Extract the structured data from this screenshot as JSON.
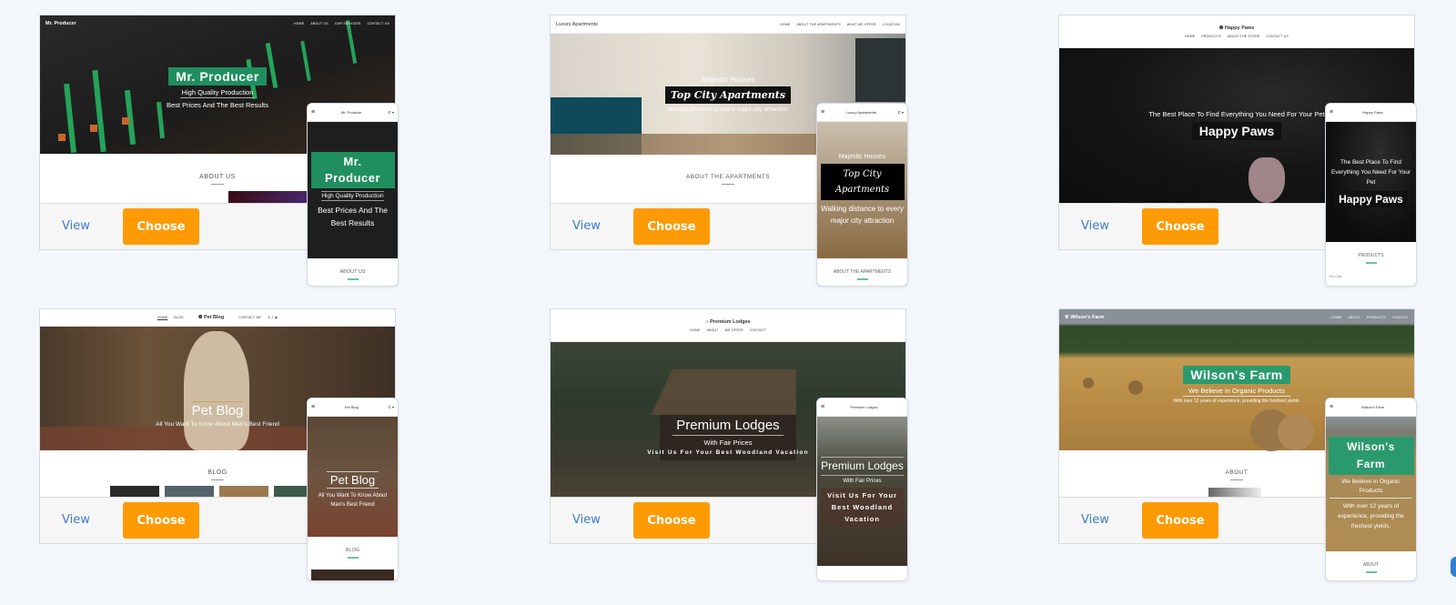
{
  "templates": [
    {
      "name": "Mr. Producer",
      "desktop": {
        "brand": "Mr. Producer",
        "nav_links": [
          "HOME",
          "ABOUT US",
          "OUR SERVICES",
          "CONTACT US"
        ],
        "hero_title": "Mr. Producer",
        "hero_subtitle": "High Quality Production",
        "hero_tagline": "Best Prices And The Best Results",
        "section_label": "ABOUT US"
      },
      "mobile": {
        "brand": "Mr. Producer",
        "hero_title": "Mr. Producer",
        "hero_subtitle": "High Quality Production",
        "hero_tagline": "Best Prices And The Best Results",
        "section_label": "ABOUT US"
      },
      "view_label": "View",
      "choose_label": "Choose"
    },
    {
      "name": "Luxury Apartments",
      "desktop": {
        "brand": "Luxury Apartments",
        "nav_links": [
          "HOME",
          "ABOUT THE APARTMENTS",
          "WHAT WE OFFER",
          "LOCATION"
        ],
        "hero_pretitle": "Majestic Houses",
        "hero_title": "Top City Apartments",
        "hero_subtitle": "Walking distance to every major city attraction",
        "section_label": "ABOUT THE APARTMENTS"
      },
      "mobile": {
        "brand": "Luxury Apartments",
        "hero_pretitle": "Majestic Houses",
        "hero_title": "Top City Apartments",
        "hero_subtitle": "Walking distance to every major city attraction",
        "section_label": "ABOUT THE APARTMENTS"
      },
      "view_label": "View",
      "choose_label": "Choose"
    },
    {
      "name": "Happy Paws",
      "desktop": {
        "brand": "Happy Paws",
        "nav_links": [
          "HOME",
          "PRODUCTS",
          "ABOUT THE STORE",
          "CONTACT US"
        ],
        "hero_pretitle": "The Best Place To Find Everything You Need For Your Pet",
        "hero_title": "Happy Paws"
      },
      "mobile": {
        "brand": "Happy Paws",
        "hero_pretitle": "The Best Place To Find Everything You Need For Your Pet",
        "hero_title": "Happy Paws",
        "section_label": "PRODUCTS",
        "extra_text": "For Cats"
      },
      "view_label": "View",
      "choose_label": "Choose"
    },
    {
      "name": "Pet Blog",
      "desktop": {
        "brand": "Pet Blog",
        "nav_links_left": [
          "HOME",
          "BLOG"
        ],
        "nav_links_right": [
          "CONTACT ME"
        ],
        "hero_title": "Pet Blog",
        "hero_subtitle": "All You Want To Know About Man's Best Friend",
        "section_label": "BLOG"
      },
      "mobile": {
        "brand": "Pet Blog",
        "hero_title": "Pet Blog",
        "hero_subtitle": "All You Want To Know About Man's Best Friend",
        "section_label": "BLOG"
      },
      "view_label": "View",
      "choose_label": "Choose"
    },
    {
      "name": "Premium Lodges",
      "desktop": {
        "brand": "Premium Lodges",
        "nav_links": [
          "HOME",
          "ABOUT",
          "WE OFFER",
          "CONTACT"
        ],
        "hero_title": "Premium Lodges",
        "hero_subtitle": "With Fair Prices",
        "hero_tagline": "Visit Us For Your Best Woodland Vacation"
      },
      "mobile": {
        "brand": "Premium Lodges",
        "hero_title": "Premium Lodges",
        "hero_subtitle": "With Fair Prices",
        "hero_tagline": "Visit Us For Your Best Woodland Vacation"
      },
      "view_label": "View",
      "choose_label": "Choose"
    },
    {
      "name": "Wilson's Farm",
      "desktop": {
        "brand": "Wilson's Farm",
        "nav_links": [
          "HOME",
          "ABOUT",
          "PRODUCTS",
          "CONTACT"
        ],
        "hero_title": "Wilson's Farm",
        "hero_subtitle": "We Believe in Organic Products",
        "hero_tagline": "With over 12 years of experience, providing the freshest yields.",
        "section_label": "ABOUT"
      },
      "mobile": {
        "brand": "Wilson's Farm",
        "hero_title": "Wilson's Farm",
        "hero_subtitle": "We Believe in Organic Products",
        "hero_tagline": "With over 12 years of experience, providing the freshest yields.",
        "section_label": "ABOUT"
      },
      "view_label": "View",
      "choose_label": "Choose"
    }
  ],
  "colors": {
    "page_bg": "#f3f7fc",
    "choose_button": "#fd9a04",
    "view_link": "#3d7cc9",
    "producer_green": "#1f8f5f",
    "farm_green": "#2a9a6e"
  }
}
